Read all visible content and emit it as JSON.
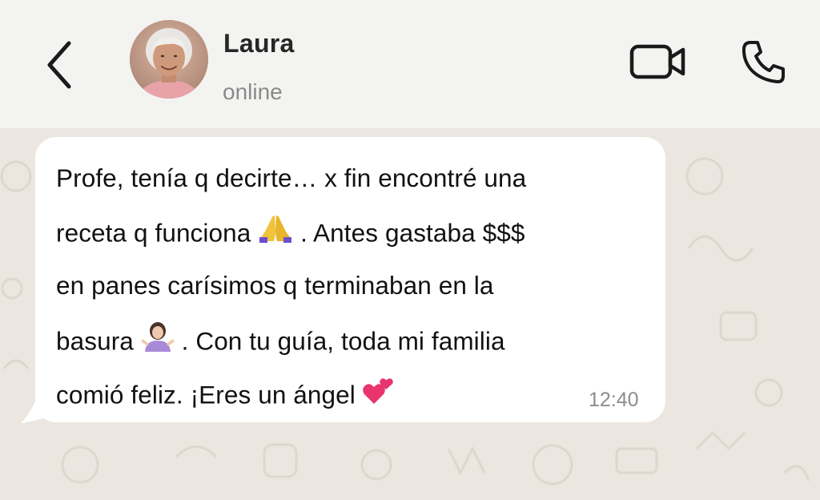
{
  "header": {
    "contact_name": "Laura",
    "contact_status": "online",
    "back_icon": "chevron-left-icon",
    "video_icon": "video-camera-icon",
    "call_icon": "phone-icon"
  },
  "message": {
    "lines": [
      "Profe, tenía q decirte… x fin encontré una",
      "receta q funciona",
      ". Antes gastaba $$$",
      "en panes carísimos q terminaban en la",
      "basura",
      ". Con tu guía, toda mi familia",
      "comió feliz. ¡Eres un ángel"
    ],
    "emojis": [
      "praying-hands-emoji",
      "woman-shrugging-emoji",
      "two-hearts-emoji"
    ],
    "time": "12:40"
  },
  "colors": {
    "header_bg": "#f3f3f1",
    "chat_bg": "#ebe6df",
    "bubble_bg": "#ffffff",
    "text": "#111111",
    "muted": "#8a8a8a"
  }
}
